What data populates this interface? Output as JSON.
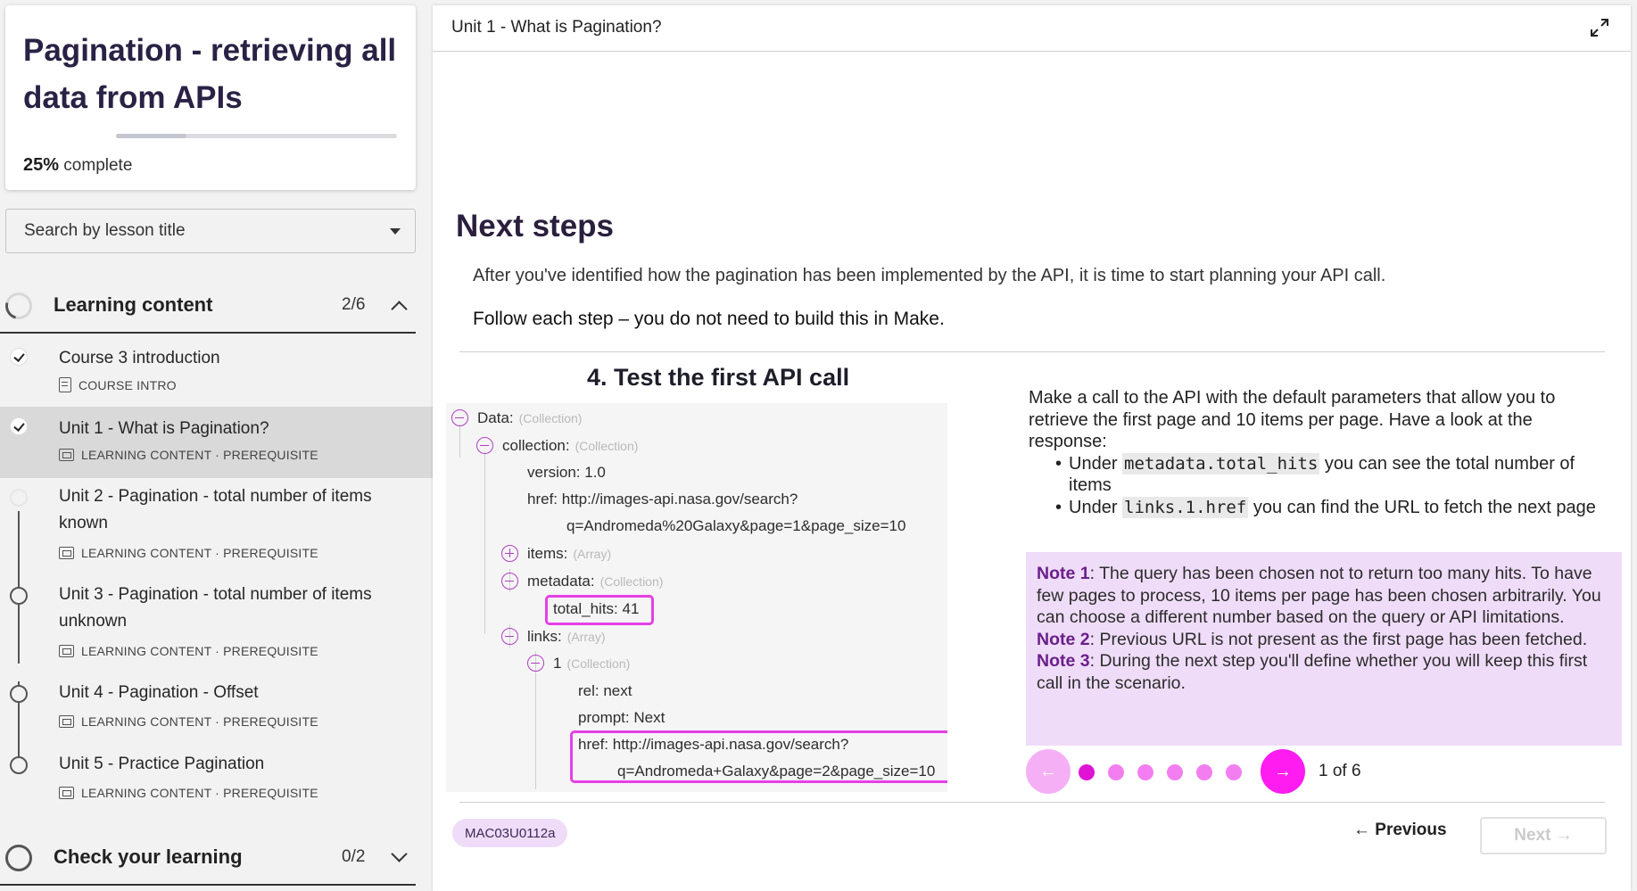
{
  "course": {
    "title": "Pagination - retrieving all data from APIs",
    "progress_percent": 25,
    "progress_value": "25%",
    "progress_suffix": " complete"
  },
  "search": {
    "placeholder": "Search by lesson title"
  },
  "sections": [
    {
      "label": "Learning content",
      "count": "2/6",
      "expanded": true
    },
    {
      "label": "Check your learning",
      "count": "0/2",
      "expanded": false
    }
  ],
  "lessons": [
    {
      "title": "Course 3 introduction",
      "meta": "COURSE INTRO",
      "status": "done"
    },
    {
      "title": "Unit 1 - What is Pagination?",
      "meta": "LEARNING CONTENT · PREREQUISITE",
      "status": "done",
      "active": true
    },
    {
      "title": "Unit 2 - Pagination - total number of items known",
      "meta": "LEARNING CONTENT · PREREQUISITE",
      "status": "todo"
    },
    {
      "title": "Unit 3 - Pagination - total number of items unknown",
      "meta": "LEARNING CONTENT · PREREQUISITE",
      "status": "todo"
    },
    {
      "title": "Unit 4 - Pagination - Offset",
      "meta": "LEARNING CONTENT · PREREQUISITE",
      "status": "todo"
    },
    {
      "title": "Unit 5 - Practice Pagination",
      "meta": "LEARNING CONTENT · PREREQUISITE",
      "status": "todo"
    }
  ],
  "main": {
    "breadcrumb": "Unit 1 - What is Pagination?",
    "heading": "Next steps",
    "intro": "After you've identified how the pagination has been implemented by the API, it is time to start planning your API call.",
    "follow": "Follow each step – you do not need to build this in Make."
  },
  "step": {
    "title": "4. Test the first API call",
    "tree": {
      "data_key": "Data:",
      "data_type": "(Collection)",
      "collection_key": "collection:",
      "collection_type": "(Collection)",
      "version": "version: 1.0",
      "href1": "href: http://images-api.nasa.gov/search?",
      "href1_cont": "q=Andromeda%20Galaxy&page=1&page_size=10",
      "items_key": "items:",
      "items_type": "(Array)",
      "metadata_key": "metadata:",
      "metadata_type": "(Collection)",
      "total_hits": "total_hits: 41",
      "links_key": "links:",
      "links_type": "(Array)",
      "one_key": "1",
      "one_type": "(Collection)",
      "rel": "rel: next",
      "prompt": "prompt: Next",
      "href2": "href: http://images-api.nasa.gov/search?",
      "href2_cont": "q=Andromeda+Galaxy&page=2&page_size=10"
    },
    "desc": "Make a call to the API with the default parameters that allow you to retrieve the first page and 10 items per page. Have a look at the response:",
    "bullet1_pre": "Under ",
    "bullet1_code": "metadata.total_hits",
    "bullet1_post": " you can see the total number of items",
    "bullet2_pre": "Under ",
    "bullet2_code": "links.1.href",
    "bullet2_post": " you can find the URL to fetch the next page",
    "notes": [
      {
        "label": "Note 1",
        "text": ": The query has been chosen not to return too many hits. To have few pages to process, 10 items per page has been chosen arbitrarily. You can choose a different number based on the query or API limitations."
      },
      {
        "label": "Note 2",
        "text": ": Previous URL is not present as the first page has been fetched."
      },
      {
        "label": "Note 3",
        "text": ": During the next step you'll define whether you will keep this first call in the scenario."
      }
    ]
  },
  "carousel": {
    "current": 1,
    "total": 6,
    "counter": "1 of 6"
  },
  "footer": {
    "lesson_code": "MAC03U0112a",
    "previous_label": "← Previous",
    "next_label": "Next →"
  },
  "colors": {
    "accent": "#ff1cf0",
    "note_bg": "#efdcf8",
    "highlight": "#e63fe6",
    "title": "#2a2245"
  }
}
